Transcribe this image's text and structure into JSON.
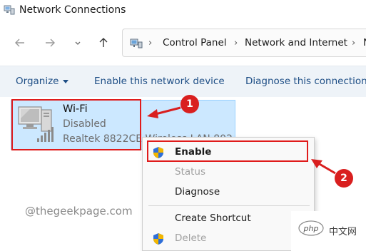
{
  "window": {
    "title": "Network Connections",
    "title_icon": "network-connections-icon"
  },
  "nav": {
    "back_icon": "arrow-left-icon",
    "forward_icon": "arrow-right-icon",
    "up_icon": "arrow-up-icon"
  },
  "address_bar": {
    "icon": "control-panel-network-icon",
    "breadcrumbs": [
      "Control Panel",
      "Network and Internet",
      "N"
    ]
  },
  "command_bar": {
    "organize": "Organize",
    "enable_device": "Enable this network device",
    "diagnose": "Diagnose this connection"
  },
  "adapter": {
    "name": "Wi-Fi",
    "status": "Disabled",
    "device": "Realtek 8822CE Wireless LAN 802"
  },
  "context_menu": {
    "items": [
      {
        "label": "Enable",
        "icon": "uac-shield-icon",
        "enabled": true
      },
      {
        "label": "Status",
        "enabled": false
      },
      {
        "label": "Diagnose",
        "enabled": true
      },
      {
        "label": "Create Shortcut",
        "enabled": true
      },
      {
        "label": "Delete",
        "icon": "uac-shield-icon",
        "enabled": false
      }
    ]
  },
  "annotations": {
    "step1": "1",
    "step2": "2",
    "highlight_color": "#e01b1b"
  },
  "watermark": "@thegeekpage.com",
  "corner_logo": {
    "text": "中文网",
    "logo_text": "php"
  },
  "colors": {
    "selection_fill": "#cce8ff",
    "command_text": "#1f4f86",
    "badge": "#d91f1f"
  }
}
